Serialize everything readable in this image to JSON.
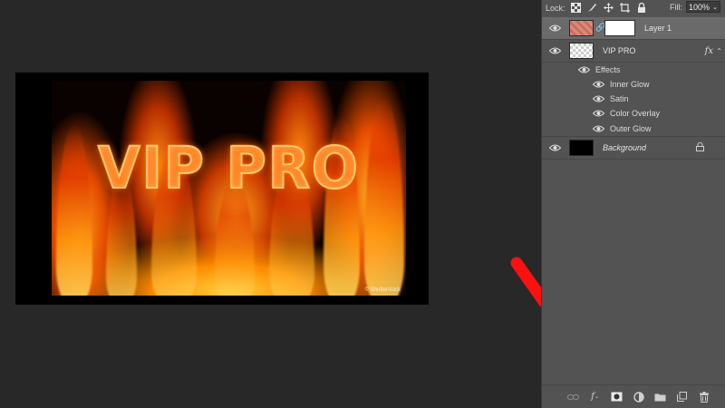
{
  "layers_panel": {
    "lock_label": "Lock:",
    "lock_icons": [
      "lock-transparent-pixels-icon",
      "lock-image-pixels-icon",
      "lock-position-icon",
      "lock-artboard-icon",
      "lock-all-icon"
    ],
    "fill_label": "Fill:",
    "fill_value": "100%",
    "layers": [
      {
        "name": "Layer 1",
        "selected": true
      },
      {
        "name": "VIP PRO",
        "fx": "fx"
      },
      {
        "name": "Background",
        "locked": true
      }
    ],
    "effects_label": "Effects",
    "effects": [
      "Inner Glow",
      "Satin",
      "Color Overlay",
      "Outer Glow"
    ],
    "bottom_icons": [
      "link-layers-icon",
      "add-layer-style-icon",
      "add-layer-mask-icon",
      "adjustment-layer-icon",
      "new-group-icon",
      "new-layer-icon",
      "delete-layer-icon"
    ]
  },
  "canvas": {
    "art_text": "VIP PRO",
    "watermark": "© Shutterstock"
  },
  "colors": {
    "panel_bg": "#535353",
    "workspace_bg": "#282828",
    "annotation": "#ff1010"
  }
}
